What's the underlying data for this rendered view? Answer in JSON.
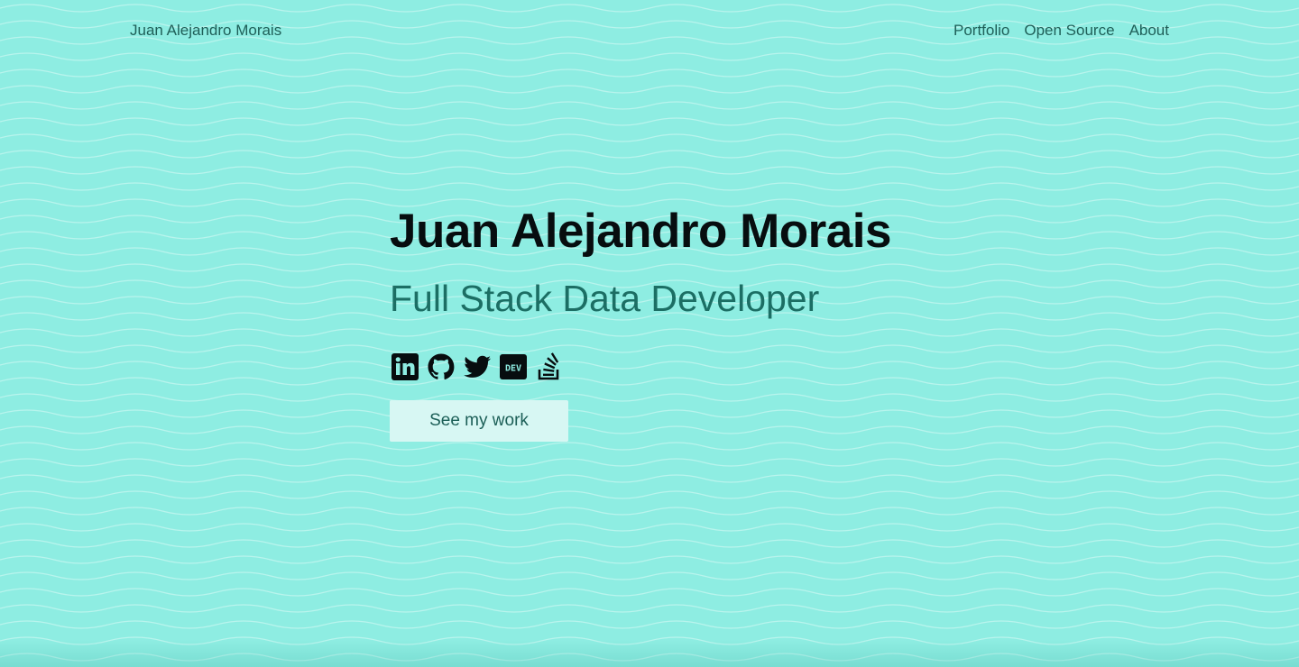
{
  "nav": {
    "brand": "Juan Alejandro Morais",
    "links": [
      "Portfolio",
      "Open Source",
      "About"
    ]
  },
  "hero": {
    "title": "Juan Alejandro Morais",
    "subtitle": "Full Stack Data Developer",
    "cta_label": "See my work"
  },
  "socials": [
    {
      "icon": "linkedin-icon"
    },
    {
      "icon": "github-icon"
    },
    {
      "icon": "twitter-icon"
    },
    {
      "icon": "dev-icon",
      "text": "DEV"
    },
    {
      "icon": "stackoverflow-icon"
    }
  ],
  "colors": {
    "background": "#8eede2",
    "wave_line": "#c4f6f0",
    "title": "#070d0f",
    "subtitle": "#1c6e64",
    "nav_text": "#1f5f58",
    "button_bg": "#d7f7f3",
    "button_text": "#1c5f57"
  }
}
